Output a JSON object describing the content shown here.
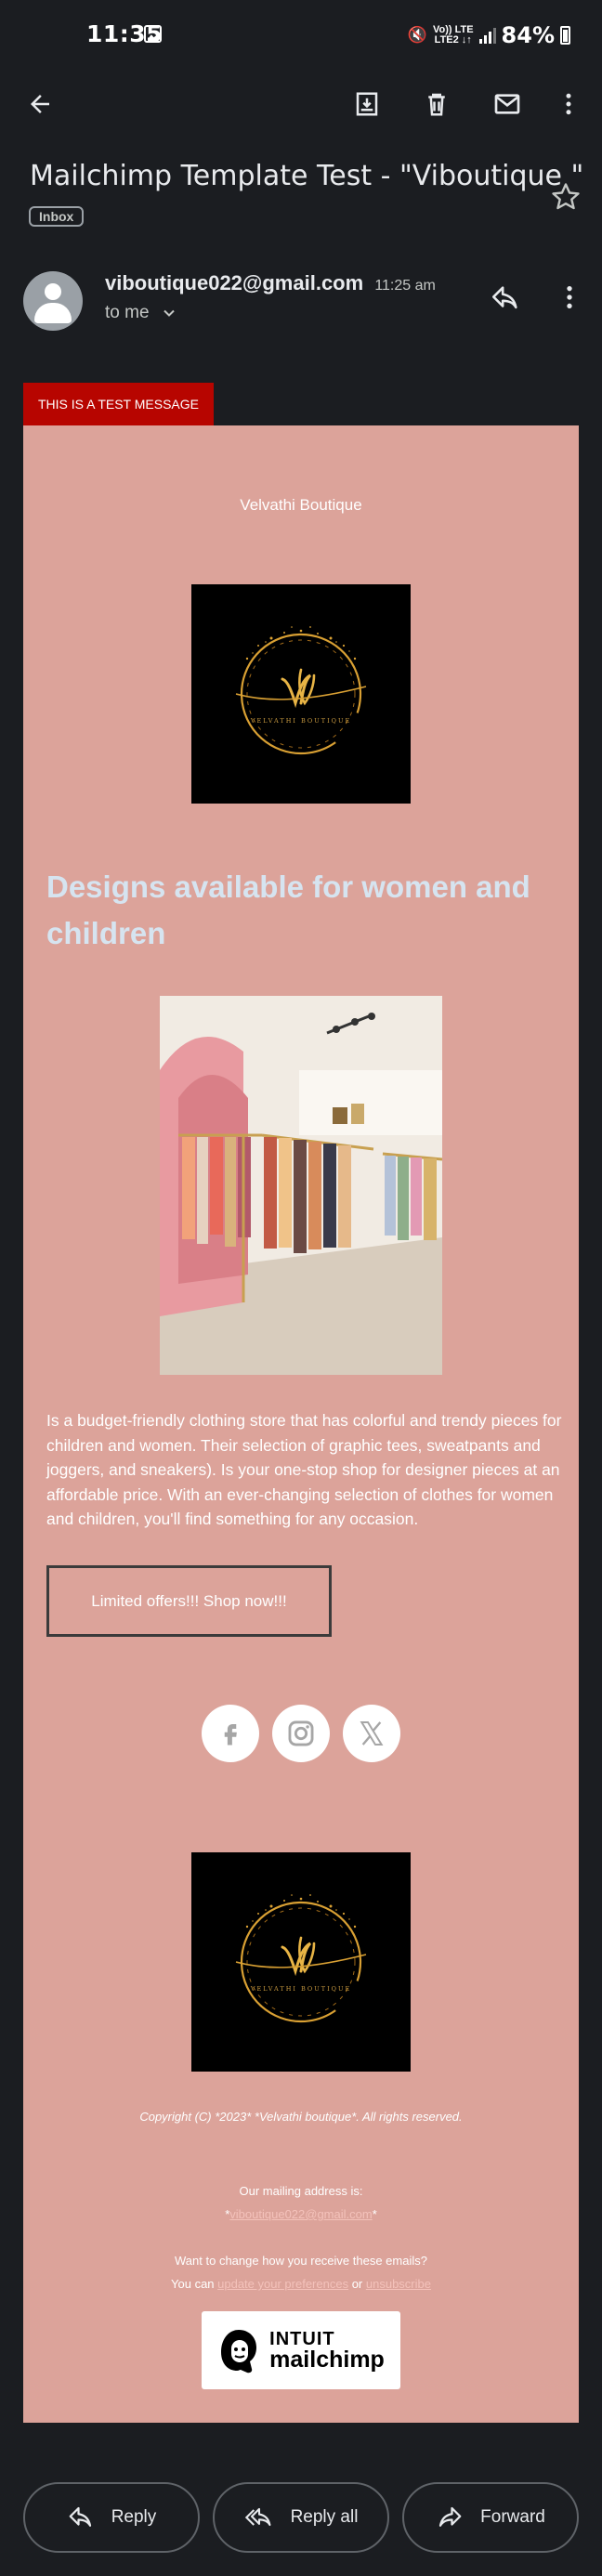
{
  "status_bar": {
    "time": "11:35",
    "network": "Vo)) LTE",
    "battery": "84%"
  },
  "email": {
    "subject": "Mailchimp Template Test - \"Viboutique \"",
    "label": "Inbox",
    "sender": "viboutique022@gmail.com",
    "time": "11:25 am",
    "recipient": "to me"
  },
  "body": {
    "test_banner": "THIS IS A TEST MESSAGE",
    "brand_name": "Velvathi Boutique",
    "logo_text": "VELVATHI BOUTIQUE",
    "headline": "Designs available for women and children",
    "description": " Is a budget-friendly clothing store that has colorful and trendy pieces for children and women. Their selection of graphic tees, sweatpants and joggers, and sneakers). Is your one-stop shop for designer pieces at an affordable price. With an ever-changing selection of clothes for women and children, you'll find something for any occasion.",
    "cta_label": "Limited offers!!! Shop now!!!",
    "socials": [
      "facebook-icon",
      "instagram-icon",
      "x-icon"
    ],
    "copyright": "Copyright (C) *2023* *Velvathi boutique*. All rights reserved.",
    "address_label": "Our mailing address is:",
    "address_prefix": "*",
    "address_email": "viboutique022@gmail.com",
    "address_suffix": "*",
    "change_question": "Want to change how you receive these emails?",
    "change_prefix": "You can ",
    "update_link": "update your preferences",
    "or_text": " or ",
    "unsubscribe_link": "unsubscribe",
    "badge_line1": "INTUIT",
    "badge_line2": "mailchimp"
  },
  "actions": {
    "reply": "Reply",
    "reply_all": "Reply all",
    "forward": "Forward"
  },
  "colors": {
    "background": "#1b1d21",
    "email_bg": "#dca39a",
    "banner": "#b70500",
    "headline": "#d6e4f0",
    "logo_gold": "#d9a033"
  }
}
